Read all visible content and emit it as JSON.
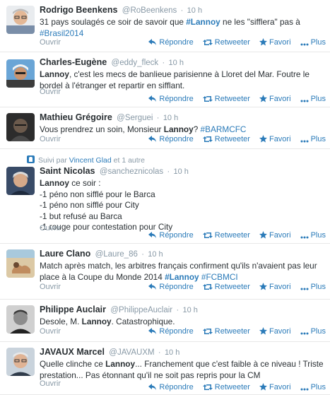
{
  "actions": {
    "reply": "Répondre",
    "retweet": "Retweeter",
    "favorite": "Favori",
    "more": "Plus",
    "expand": "Ouvrir"
  },
  "colors": {
    "link": "#2b7bb9",
    "muted": "#8899a6",
    "text": "#292f33"
  },
  "tweets": [
    {
      "name": "Rodrigo Beenkens",
      "handle": "@RoBeenkens",
      "time": "10 h",
      "text_parts": [
        "31 pays soulagés ce soir de savoir que ",
        "#Lannoy",
        " ne les \"sifflera\" pas à ",
        "#Brasil2014"
      ],
      "avatar": "portrait-glasses"
    },
    {
      "name": "Charles-Eugène",
      "handle": "@eddy_fleck",
      "time": "10 h",
      "text_parts": [
        "Lannoy",
        ", c'est les mecs de banlieue parisienne à Lloret del Mar. Foutre le bordel à l'étranger et repartir en sifflant."
      ],
      "avatar": "portrait-headwrap"
    },
    {
      "name": "Mathieu Grégoire",
      "handle": "@Serguei",
      "time": "10 h",
      "text_parts": [
        "Vous prendrez un soin, Monsieur ",
        "Lannoy",
        "? ",
        "#BARMCFC"
      ],
      "avatar": "portrait-dark"
    },
    {
      "context": {
        "label": "Suivi par",
        "user": "Vincent Glad",
        "suffix": "et 1 autre"
      },
      "name": "Saint Nicolas",
      "handle": "@sancheznicolas",
      "time": "10 h",
      "text_parts": [
        "Lannoy",
        " ce soir :"
      ],
      "lines": [
        "-1 péno non sifflé pour le Barca",
        "-1 péno non sifflé pour City",
        "-1 but refusé au Barca",
        "-1 rouge pour contestation pour City"
      ],
      "avatar": "portrait-grey-hair"
    },
    {
      "name": "Laure Clano",
      "handle": "@Laure_86",
      "time": "10 h",
      "text_parts": [
        "Match après match, les arbitres français confirment qu'ils n'avaient pas leur place à la Coupe du Monde 2014 ",
        "#Lannoy",
        " ",
        "#FCBMCI"
      ],
      "avatar": "beach"
    },
    {
      "name": "Philippe Auclair",
      "handle": "@PhilippeAuclair",
      "time": "10 h",
      "text_parts": [
        "Desole, M. ",
        "Lannoy",
        ". Catastrophique."
      ],
      "avatar": "portrait-bw"
    },
    {
      "name": "JAVAUX Marcel",
      "handle": "@JAVAUXM",
      "time": "10 h",
      "text_parts": [
        "Quelle clinche ce ",
        "Lannoy",
        "... Franchement que c'est faible à ce niveau ! Triste prestation... Pas étonnant qu'il ne soit pas repris pour la CM"
      ],
      "avatar": "portrait-glasses-old"
    }
  ]
}
